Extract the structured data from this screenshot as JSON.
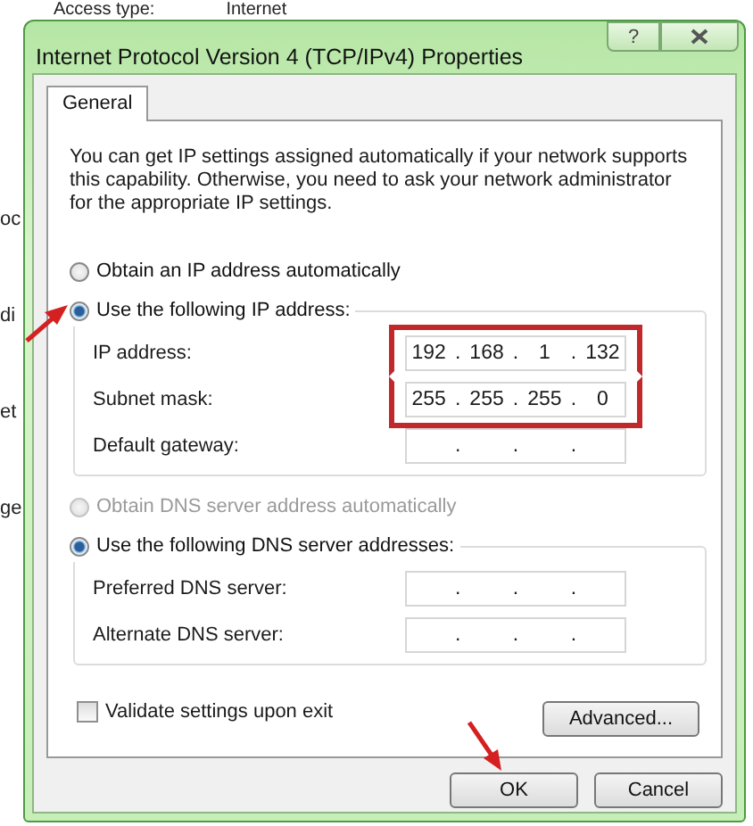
{
  "background_window": {
    "top_label": "Access type:",
    "top_value": "Internet",
    "edge_texts": [
      "oc",
      "di",
      "et",
      "ge"
    ]
  },
  "window": {
    "title": "Internet Protocol Version 4 (TCP/IPv4) Properties",
    "help_glyph": "?"
  },
  "tabs": [
    {
      "label": "General",
      "selected": true
    }
  ],
  "description": "You can get IP settings assigned automatically if your network supports this capability. Otherwise, you need to ask your network administrator for the appropriate IP settings.",
  "ip_options": [
    {
      "label": "Obtain an IP address automatically",
      "selected": false,
      "disabled": false
    },
    {
      "label": "Use the following IP address:",
      "selected": true,
      "disabled": false
    }
  ],
  "ip_fields": [
    {
      "label": "IP address:",
      "separator": ".",
      "octets": [
        "192",
        "168",
        "1",
        "132"
      ],
      "highlighted": true
    },
    {
      "label": "Subnet mask:",
      "separator": ".",
      "octets": [
        "255",
        "255",
        "255",
        "0"
      ],
      "highlighted": true
    },
    {
      "label": "Default gateway:",
      "separator": ".",
      "highlighted": false
    }
  ],
  "dns_options": [
    {
      "label": "Obtain DNS server address automatically",
      "selected": false,
      "disabled": true
    },
    {
      "label": "Use the following DNS server addresses:",
      "selected": true,
      "disabled": false
    }
  ],
  "dns_fields": [
    {
      "label": "Preferred DNS server:",
      "separator": "."
    },
    {
      "label": "Alternate DNS server:",
      "separator": "."
    }
  ],
  "validate": {
    "label": "Validate settings upon exit",
    "checked": false
  },
  "advanced_button": "Advanced...",
  "buttons": [
    "OK",
    "Cancel"
  ]
}
